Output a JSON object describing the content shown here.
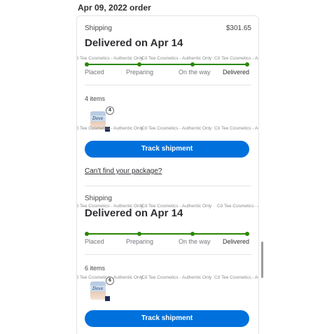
{
  "order": {
    "date_label": "Apr 09, 2022 order",
    "total": "$301.65"
  },
  "watermark_text": "Cô Tee Cosmetics - Authentic Only",
  "shipments": [
    {
      "method": "Shipping",
      "status": "Delivered on Apr 14",
      "steps": [
        "Placed",
        "Preparing",
        "On the way",
        "Delivered"
      ],
      "items_count": "4 items",
      "item_badge": "4",
      "item_brand": "Dove",
      "track_label": "Track shipment",
      "help_link": "Can't find your package?"
    },
    {
      "method": "Shipping",
      "status": "Delivered on Apr 14",
      "steps": [
        "Placed",
        "Preparing",
        "On the way",
        "Delivered"
      ],
      "items_count": "6 items",
      "item_badge": "6",
      "item_brand": "Dove",
      "track_label": "Track shipment"
    }
  ],
  "colors": {
    "progress": "#2a8703",
    "button": "#0071dc"
  }
}
